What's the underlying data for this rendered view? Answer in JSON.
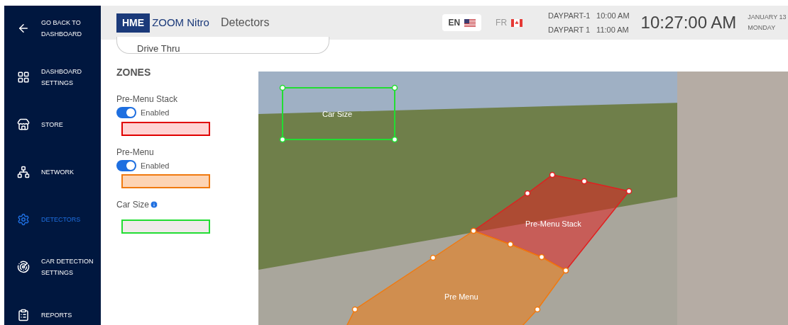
{
  "sidebar": {
    "back": {
      "label": "GO BACK TO DASHBOARD"
    },
    "items": [
      {
        "label": "DASHBOARD SETTINGS",
        "kind": "grid",
        "selected": false
      },
      {
        "label": "STORE",
        "kind": "store",
        "selected": false
      },
      {
        "label": "NETWORK",
        "kind": "network",
        "selected": false
      },
      {
        "label": "DETECTORS",
        "kind": "gear",
        "selected": true
      },
      {
        "label": "CAR DETECTION SETTINGS",
        "kind": "radar",
        "selected": false
      },
      {
        "label": "REPORTS",
        "kind": "clipboard",
        "selected": false
      }
    ]
  },
  "header": {
    "logo": "HME",
    "product": "ZOOM Nitro",
    "page_title": "Detectors",
    "languages": [
      {
        "code": "EN",
        "kind": "us",
        "selected": true
      },
      {
        "code": "FR",
        "kind": "ca",
        "selected": false
      }
    ],
    "dayparts": [
      {
        "name": "DAYPART-1",
        "time": "10:00 AM"
      },
      {
        "name": "DAYPART 1",
        "time": "11:00 AM"
      }
    ],
    "clock": "10:27:00 AM",
    "date": "JANUARY 13",
    "weekday": "MONDAY"
  },
  "lane_field": {
    "value": "Drive Thru"
  },
  "zones": {
    "heading": "ZONES",
    "items": [
      {
        "name": "Pre-Menu Stack",
        "kind": "toggle",
        "enabled": true,
        "toggle_label": "Enabled",
        "color": "#e00000"
      },
      {
        "name": "Pre-Menu",
        "kind": "toggle",
        "enabled": true,
        "toggle_label": "Enabled",
        "color": "#f07a10"
      },
      {
        "name": "Car Size",
        "kind": "info",
        "color": "#22dd33"
      }
    ]
  },
  "camera": {
    "overlays": [
      {
        "label": "Car Size",
        "kind": "rect",
        "color": "#22dd33"
      },
      {
        "label": "Pre-Menu Stack",
        "kind": "polygon",
        "color": "#e02020"
      },
      {
        "label": "Pre Menu",
        "kind": "polygon",
        "color": "#f07a10"
      }
    ]
  }
}
